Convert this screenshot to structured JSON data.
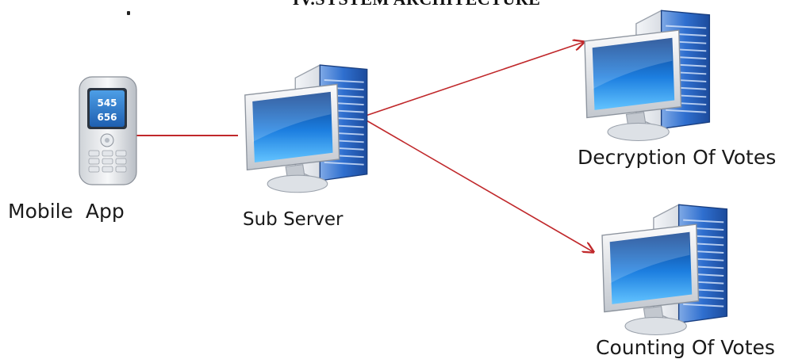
{
  "title": "IV.SYSTEM ARCHITECTURE",
  "nodes": {
    "mobile": {
      "label": "Mobile  App",
      "screen_line1": "545",
      "screen_line2": "656"
    },
    "sub_server": {
      "label": "Sub Server"
    },
    "decryption": {
      "label": "Decryption Of Votes"
    },
    "counting": {
      "label": "Counting Of Votes"
    }
  },
  "edges": [
    {
      "from": "Mobile  App",
      "to": "Sub Server",
      "style": "line"
    },
    {
      "from": "Sub Server",
      "to": "Decryption Of Votes",
      "style": "arrow"
    },
    {
      "from": "Sub Server",
      "to": "Counting Of Votes",
      "style": "arrow"
    }
  ],
  "colors": {
    "connector": "#c0282b",
    "server_blue": "#2b66c4",
    "label_text": "#1a1a1a"
  }
}
